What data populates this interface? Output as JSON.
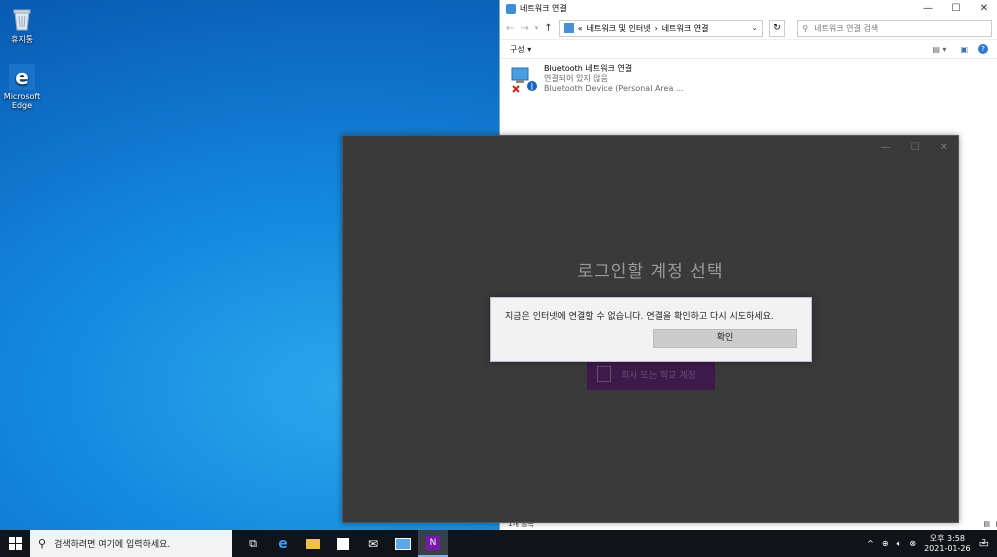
{
  "desktop": {
    "icons": [
      {
        "label": "휴지통",
        "icon": "recycle-bin-icon"
      },
      {
        "label": "Microsoft Edge",
        "icon": "edge-icon"
      }
    ]
  },
  "explorer": {
    "title": "네트워크 연결",
    "breadcrumb": [
      "네트워크 및 인터넷",
      "네트워크 연결"
    ],
    "breadcrumb_prefix": "«",
    "search_placeholder": "네트워크 연결 검색",
    "organize_label": "구성",
    "item": {
      "name": "Bluetooth 네트워크 연결",
      "status": "연결되어 있지 않음",
      "device": "Bluetooth Device (Personal Area ..."
    },
    "status_bar": "1개 항목"
  },
  "dialog": {
    "heading": "로그인할 계정 선택",
    "account_button": "회사 또는 학교 계정"
  },
  "alert": {
    "message": "지금은 인터넷에 연결할 수 없습니다. 연결을 확인하고 다시 시도하세요.",
    "ok_label": "확인"
  },
  "taskbar": {
    "search_placeholder": "검색하려면 여기에 입력하세요.",
    "time": "오후 3:58",
    "date": "2021-01-26",
    "notification_count": "2"
  },
  "colors": {
    "accent": "#0078d7",
    "dialog_bg": "#3a3a3a",
    "account_btn": "#3d1a4a"
  }
}
